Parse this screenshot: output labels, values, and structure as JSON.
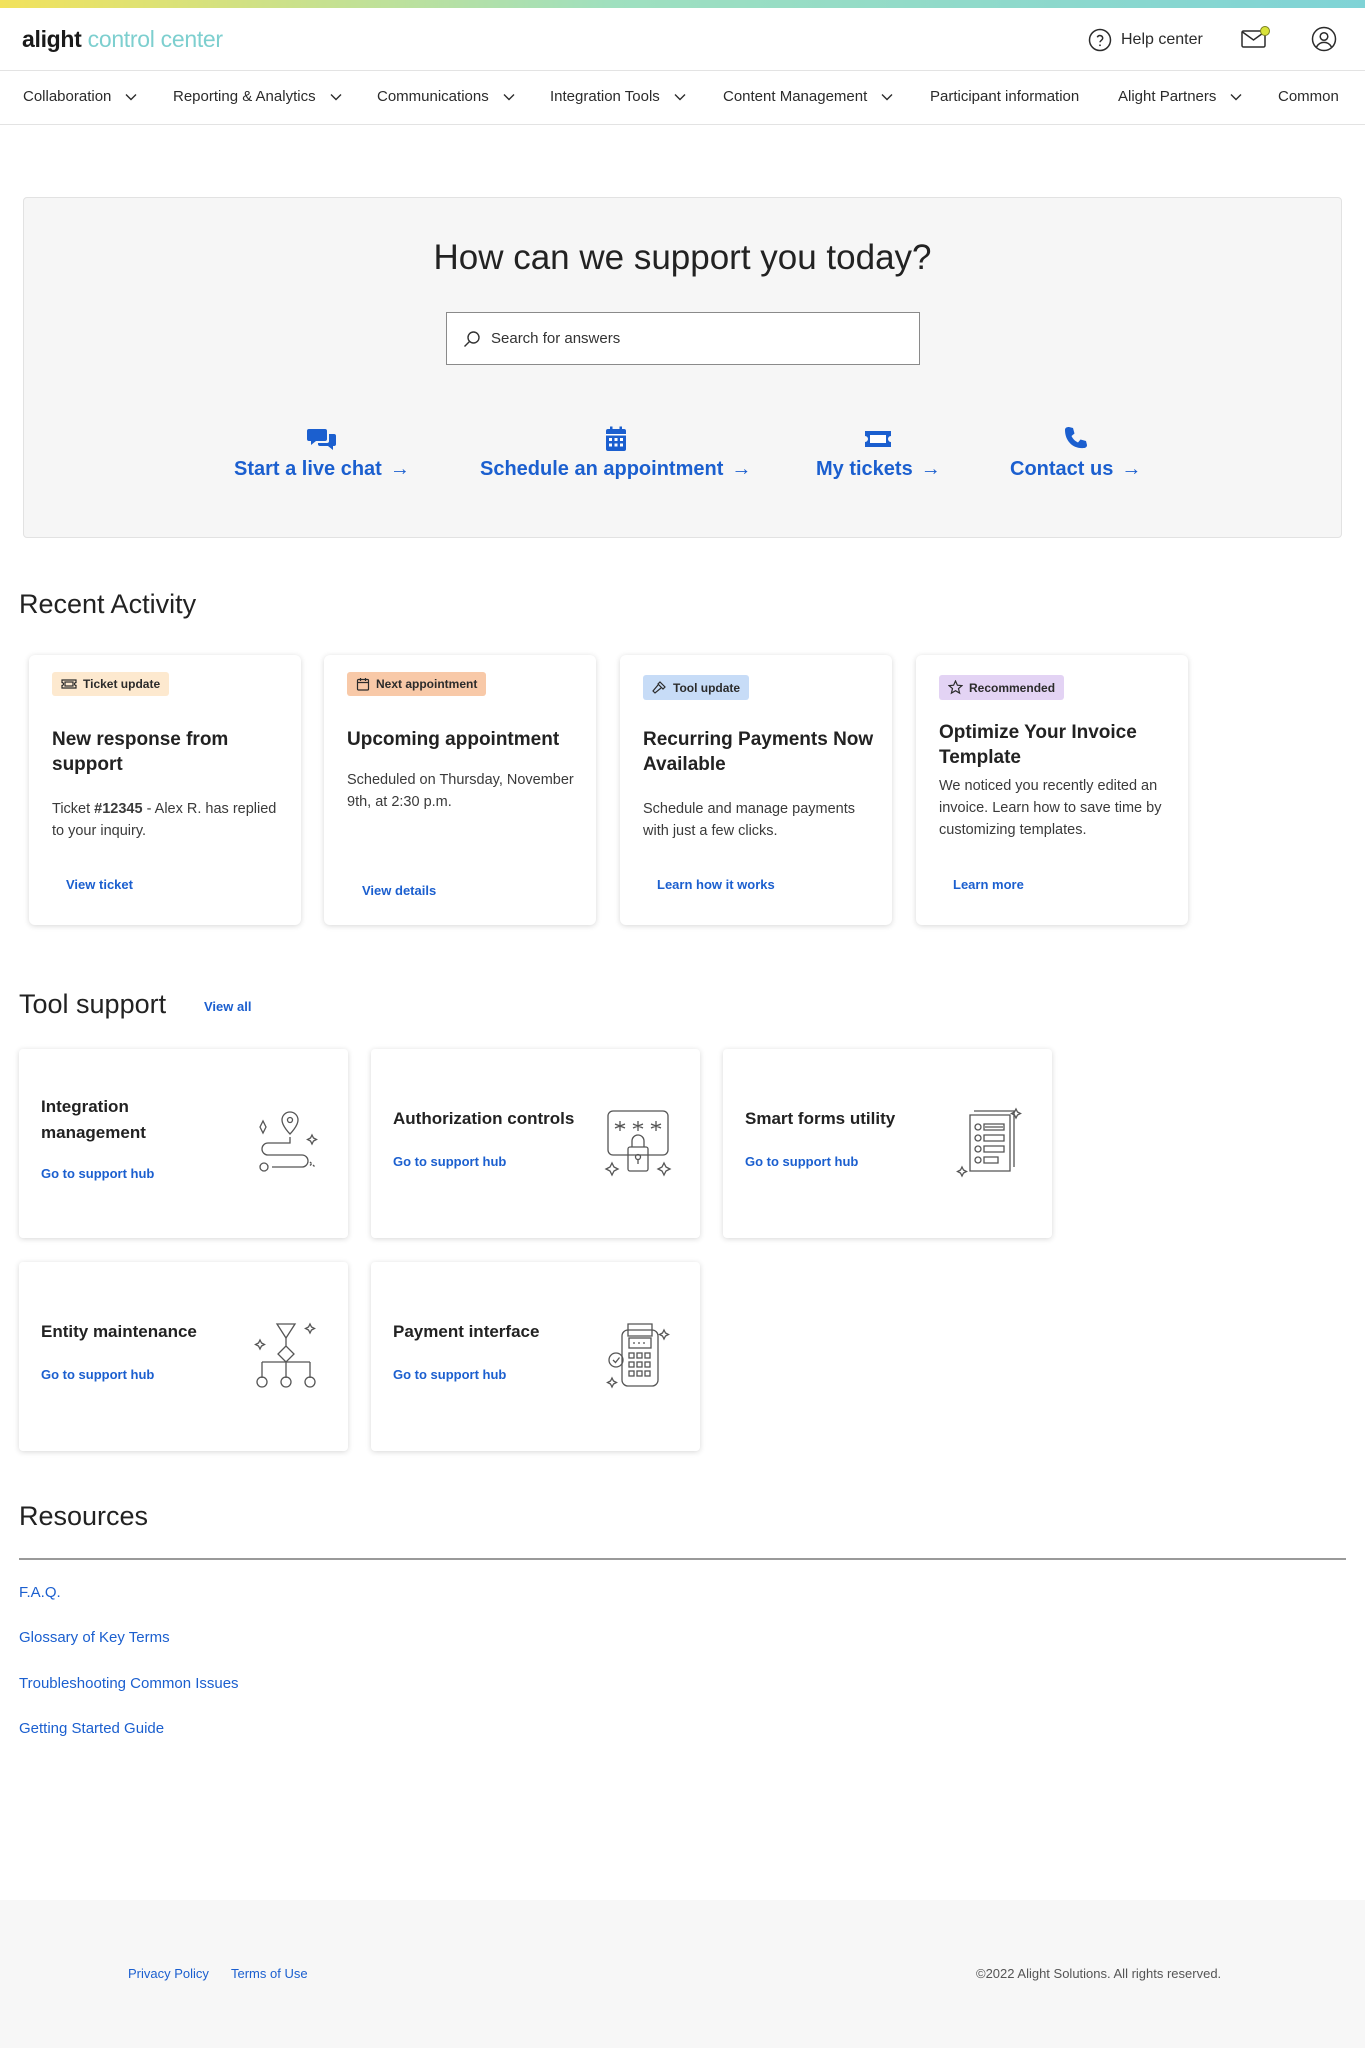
{
  "header": {
    "logo_brand": "alight",
    "logo_product": "control center",
    "help_center": "Help center"
  },
  "nav": {
    "items": [
      {
        "label": "Collaboration",
        "has_dropdown": true
      },
      {
        "label": "Reporting & Analytics",
        "has_dropdown": true
      },
      {
        "label": "Communications",
        "has_dropdown": true
      },
      {
        "label": "Integration Tools",
        "has_dropdown": true
      },
      {
        "label": "Content Management",
        "has_dropdown": true
      },
      {
        "label": "Participant information",
        "has_dropdown": false
      },
      {
        "label": "Alight Partners",
        "has_dropdown": true
      },
      {
        "label": "Common",
        "has_dropdown": false
      }
    ]
  },
  "hero": {
    "title": "How can we support you today?",
    "search_placeholder": "Search for answers",
    "actions": [
      {
        "label": "Start a live chat",
        "icon": "chat-bubbles-icon"
      },
      {
        "label": "Schedule an appointment",
        "icon": "calendar-icon"
      },
      {
        "label": "My tickets",
        "icon": "ticket-icon"
      },
      {
        "label": "Contact us",
        "icon": "phone-icon"
      }
    ]
  },
  "recent_activity": {
    "title": "Recent Activity",
    "cards": [
      {
        "badge": "Ticket update",
        "badge_color": "#fde9cf",
        "badge_icon": "ticket-icon",
        "title": "New response from support",
        "body_prefix": "Ticket ",
        "body_bold": "#12345",
        "body_suffix": " - Alex R. has replied to your inquiry.",
        "link": "View ticket"
      },
      {
        "badge": "Next appointment",
        "badge_color": "#f8c9a8",
        "badge_icon": "calendar-icon",
        "title": "Upcoming appointment",
        "body": "Scheduled on Thursday, November 9th, at 2:30 p.m.",
        "link": "View details"
      },
      {
        "badge": "Tool update",
        "badge_color": "#c7dcf7",
        "badge_icon": "hammer-icon",
        "title": "Recurring Payments Now Available",
        "body": "Schedule and manage payments with just a few clicks.",
        "link": "Learn how it works"
      },
      {
        "badge": "Recommended",
        "badge_color": "#e3d3f4",
        "badge_icon": "star-icon",
        "title": "Optimize Your Invoice Template",
        "body": "We noticed you recently edited an invoice. Learn how to save time by customizing templates.",
        "link": "Learn more"
      }
    ]
  },
  "tool_support": {
    "title": "Tool support",
    "view_all": "View all",
    "tools": [
      {
        "title": "Integration management",
        "link": "Go to support hub",
        "icon": "integration-map-icon"
      },
      {
        "title": "Authorization controls",
        "link": "Go to support hub",
        "icon": "password-lock-icon"
      },
      {
        "title": "Smart forms utility",
        "link": "Go to support hub",
        "icon": "form-checklist-icon"
      },
      {
        "title": "Entity maintenance",
        "link": "Go to support hub",
        "icon": "hierarchy-icon"
      },
      {
        "title": "Payment interface",
        "link": "Go to support hub",
        "icon": "payment-terminal-icon"
      }
    ]
  },
  "resources": {
    "title": "Resources",
    "links": [
      "F.A.Q.",
      "Glossary of Key Terms",
      "Troubleshooting Common Issues",
      "Getting Started Guide"
    ]
  },
  "footer": {
    "privacy": "Privacy Policy",
    "terms": "Terms of Use",
    "copyright": "©2022 Alight Solutions. All rights reserved."
  },
  "colors": {
    "accent_blue": "#1b5fcf",
    "logo_teal": "#7dcfcf",
    "notification_dot": "#d8e23a"
  }
}
